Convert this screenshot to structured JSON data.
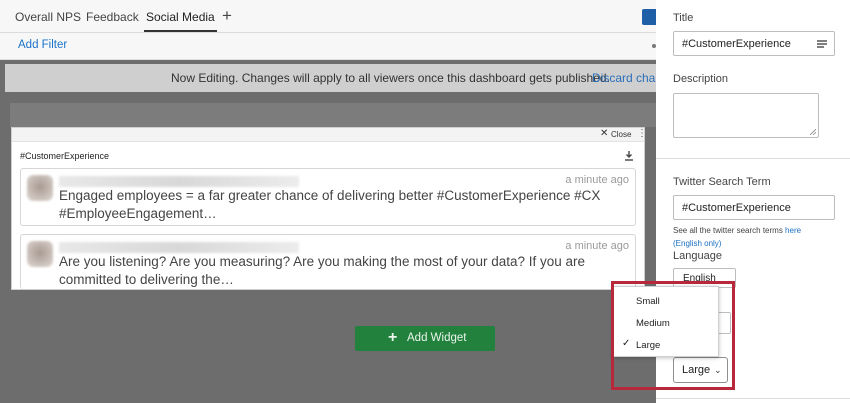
{
  "tabs": [
    {
      "label": "Overall NPS"
    },
    {
      "label": "Feedback"
    },
    {
      "label": "Social Media",
      "active": true
    }
  ],
  "filterbar": {
    "add_filter": "Add Filter"
  },
  "banner": {
    "message": "Now Editing. Changes will apply to all viewers once this dashboard gets published.",
    "discard": "Discard chang"
  },
  "widget": {
    "close_label": "Close",
    "title": "#CustomerExperience",
    "tweets": [
      {
        "time": "a minute ago",
        "text": "Engaged employees = a far greater chance of delivering better #CustomerExperience #CX #EmployeeEngagement…"
      },
      {
        "time": "a minute ago",
        "text": "Are you listening? Are you measuring? Are you making the most of your data? If you are committed to delivering the…"
      }
    ]
  },
  "add_widget": {
    "label": "Add Widget"
  },
  "panel": {
    "title_label": "Title",
    "title_value": "#CustomerExperience",
    "description_label": "Description",
    "search_term_label": "Twitter Search Term",
    "search_term_value": "#CustomerExperience",
    "hint_text": "See all the twitter search terms ",
    "hint_link1": "here",
    "hint_link2": "(English only)",
    "language_label": "Language",
    "language_value": "English",
    "size_value": "Large"
  },
  "size_dropdown": {
    "options": [
      {
        "label": "Small",
        "selected": false
      },
      {
        "label": "Medium",
        "selected": false
      },
      {
        "label": "Large",
        "selected": true
      }
    ]
  },
  "colors": {
    "accent_blue": "#1a73c8",
    "add_widget_green": "#22813c",
    "highlight_red": "#b8283a"
  }
}
